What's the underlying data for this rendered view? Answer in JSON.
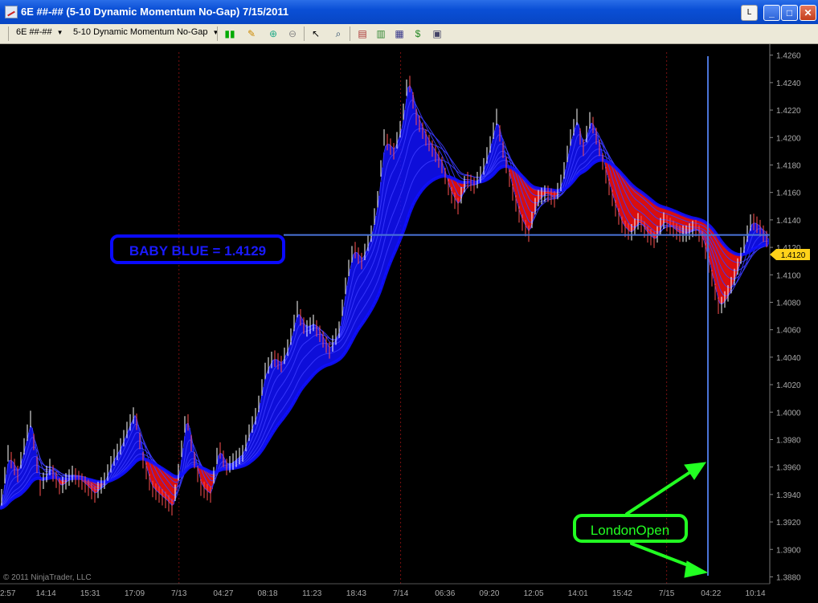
{
  "window": {
    "title": "6E ##-## (5-10 Dynamic Momentum No-Gap)  7/15/2011",
    "btn_l": "L",
    "btn_min": "_",
    "btn_max": "□",
    "btn_close": "✕"
  },
  "toolbar": {
    "instrument": "6E ##-##",
    "period": "5-10 Dynamic Momentum No-Gap",
    "icons": [
      "candlestick-style-icon",
      "pencil-draw-icon",
      "zoom-in-icon",
      "zoom-out-icon",
      "cursor-icon",
      "magnify-icon",
      "strategy-icon",
      "indicator-icon",
      "data-box-icon",
      "order-icon",
      "properties-icon"
    ]
  },
  "colors": {
    "background": "#000000",
    "up": "#1010ff",
    "down": "#ff1010",
    "baby_blue_line": "#4a74d8",
    "annotation_blue": "#0a0aff",
    "annotation_green": "#22ff22",
    "price_marker": "#ffd21a"
  },
  "chart_data": {
    "type": "line",
    "ylim": [
      1.3875,
      1.4268
    ],
    "yticks": [
      "1.4260",
      "1.4240",
      "1.4220",
      "1.4200",
      "1.4180",
      "1.4160",
      "1.4140",
      "1.4120",
      "1.4100",
      "1.4080",
      "1.4060",
      "1.4040",
      "1.4020",
      "1.4000",
      "1.3980",
      "1.3960",
      "1.3940",
      "1.3920",
      "1.3900",
      "1.3880"
    ],
    "xticks": [
      "2:57",
      "14:14",
      "15:31",
      "17:09",
      "7/13",
      "04:27",
      "08:18",
      "11:23",
      "18:43",
      "7/14",
      "06:36",
      "09:20",
      "12:05",
      "14:01",
      "15:42",
      "7/15",
      "04:22",
      "10:14"
    ],
    "session_separators": [
      "7/13",
      "7/14",
      "7/15"
    ],
    "price_path": [
      [
        0,
        1.393
      ],
      [
        10,
        1.397
      ],
      [
        22,
        1.3955
      ],
      [
        38,
        1.3995
      ],
      [
        50,
        1.3945
      ],
      [
        62,
        1.396
      ],
      [
        75,
        1.3945
      ],
      [
        90,
        1.3955
      ],
      [
        105,
        1.3948
      ],
      [
        118,
        1.394
      ],
      [
        130,
        1.395
      ],
      [
        140,
        1.3965
      ],
      [
        150,
        1.3975
      ],
      [
        160,
        1.399
      ],
      [
        168,
        1.4
      ],
      [
        178,
        1.3965
      ],
      [
        188,
        1.3945
      ],
      [
        198,
        1.394
      ],
      [
        208,
        1.3935
      ],
      [
        215,
        1.393
      ],
      [
        223,
        1.396
      ],
      [
        232,
        1.4
      ],
      [
        240,
        1.397
      ],
      [
        250,
        1.3945
      ],
      [
        262,
        1.394
      ],
      [
        272,
        1.3975
      ],
      [
        282,
        1.396
      ],
      [
        292,
        1.3965
      ],
      [
        302,
        1.397
      ],
      [
        310,
        1.3985
      ],
      [
        320,
        1.4
      ],
      [
        330,
        1.403
      ],
      [
        340,
        1.404
      ],
      [
        350,
        1.4035
      ],
      [
        360,
        1.405
      ],
      [
        370,
        1.4075
      ],
      [
        380,
        1.406
      ],
      [
        390,
        1.4065
      ],
      [
        400,
        1.4055
      ],
      [
        410,
        1.4045
      ],
      [
        422,
        1.406
      ],
      [
        432,
        1.41
      ],
      [
        440,
        1.412
      ],
      [
        450,
        1.411
      ],
      [
        462,
        1.413
      ],
      [
        470,
        1.4155
      ],
      [
        478,
        1.42
      ],
      [
        490,
        1.419
      ],
      [
        500,
        1.421
      ],
      [
        508,
        1.4245
      ],
      [
        518,
        1.4215
      ],
      [
        530,
        1.42
      ],
      [
        540,
        1.419
      ],
      [
        550,
        1.418
      ],
      [
        560,
        1.416
      ],
      [
        570,
        1.415
      ],
      [
        580,
        1.417
      ],
      [
        590,
        1.4165
      ],
      [
        600,
        1.4175
      ],
      [
        610,
        1.4195
      ],
      [
        618,
        1.4215
      ],
      [
        628,
        1.4185
      ],
      [
        638,
        1.416
      ],
      [
        648,
        1.414
      ],
      [
        658,
        1.413
      ],
      [
        668,
        1.4155
      ],
      [
        680,
        1.416
      ],
      [
        690,
        1.4155
      ],
      [
        700,
        1.417
      ],
      [
        710,
        1.42
      ],
      [
        718,
        1.4215
      ],
      [
        725,
        1.419
      ],
      [
        735,
        1.4215
      ],
      [
        745,
        1.4195
      ],
      [
        755,
        1.417
      ],
      [
        765,
        1.415
      ],
      [
        775,
        1.4135
      ],
      [
        785,
        1.413
      ],
      [
        795,
        1.414
      ],
      [
        805,
        1.413
      ],
      [
        815,
        1.4125
      ],
      [
        825,
        1.414
      ],
      [
        835,
        1.4135
      ],
      [
        845,
        1.413
      ],
      [
        855,
        1.413
      ],
      [
        865,
        1.4135
      ],
      [
        875,
        1.4125
      ],
      [
        885,
        1.41
      ],
      [
        895,
        1.4075
      ],
      [
        905,
        1.4085
      ],
      [
        915,
        1.41
      ],
      [
        925,
        1.412
      ],
      [
        935,
        1.414
      ],
      [
        945,
        1.4135
      ],
      [
        955,
        1.4125
      ]
    ],
    "last_price": "1.4120",
    "baby_blue_level": 1.4129,
    "annotations": {
      "baby_blue": "BABY BLUE = 1.4129",
      "london_open": "LondonOpen"
    },
    "copyright": "© 2011 NinjaTrader, LLC"
  }
}
